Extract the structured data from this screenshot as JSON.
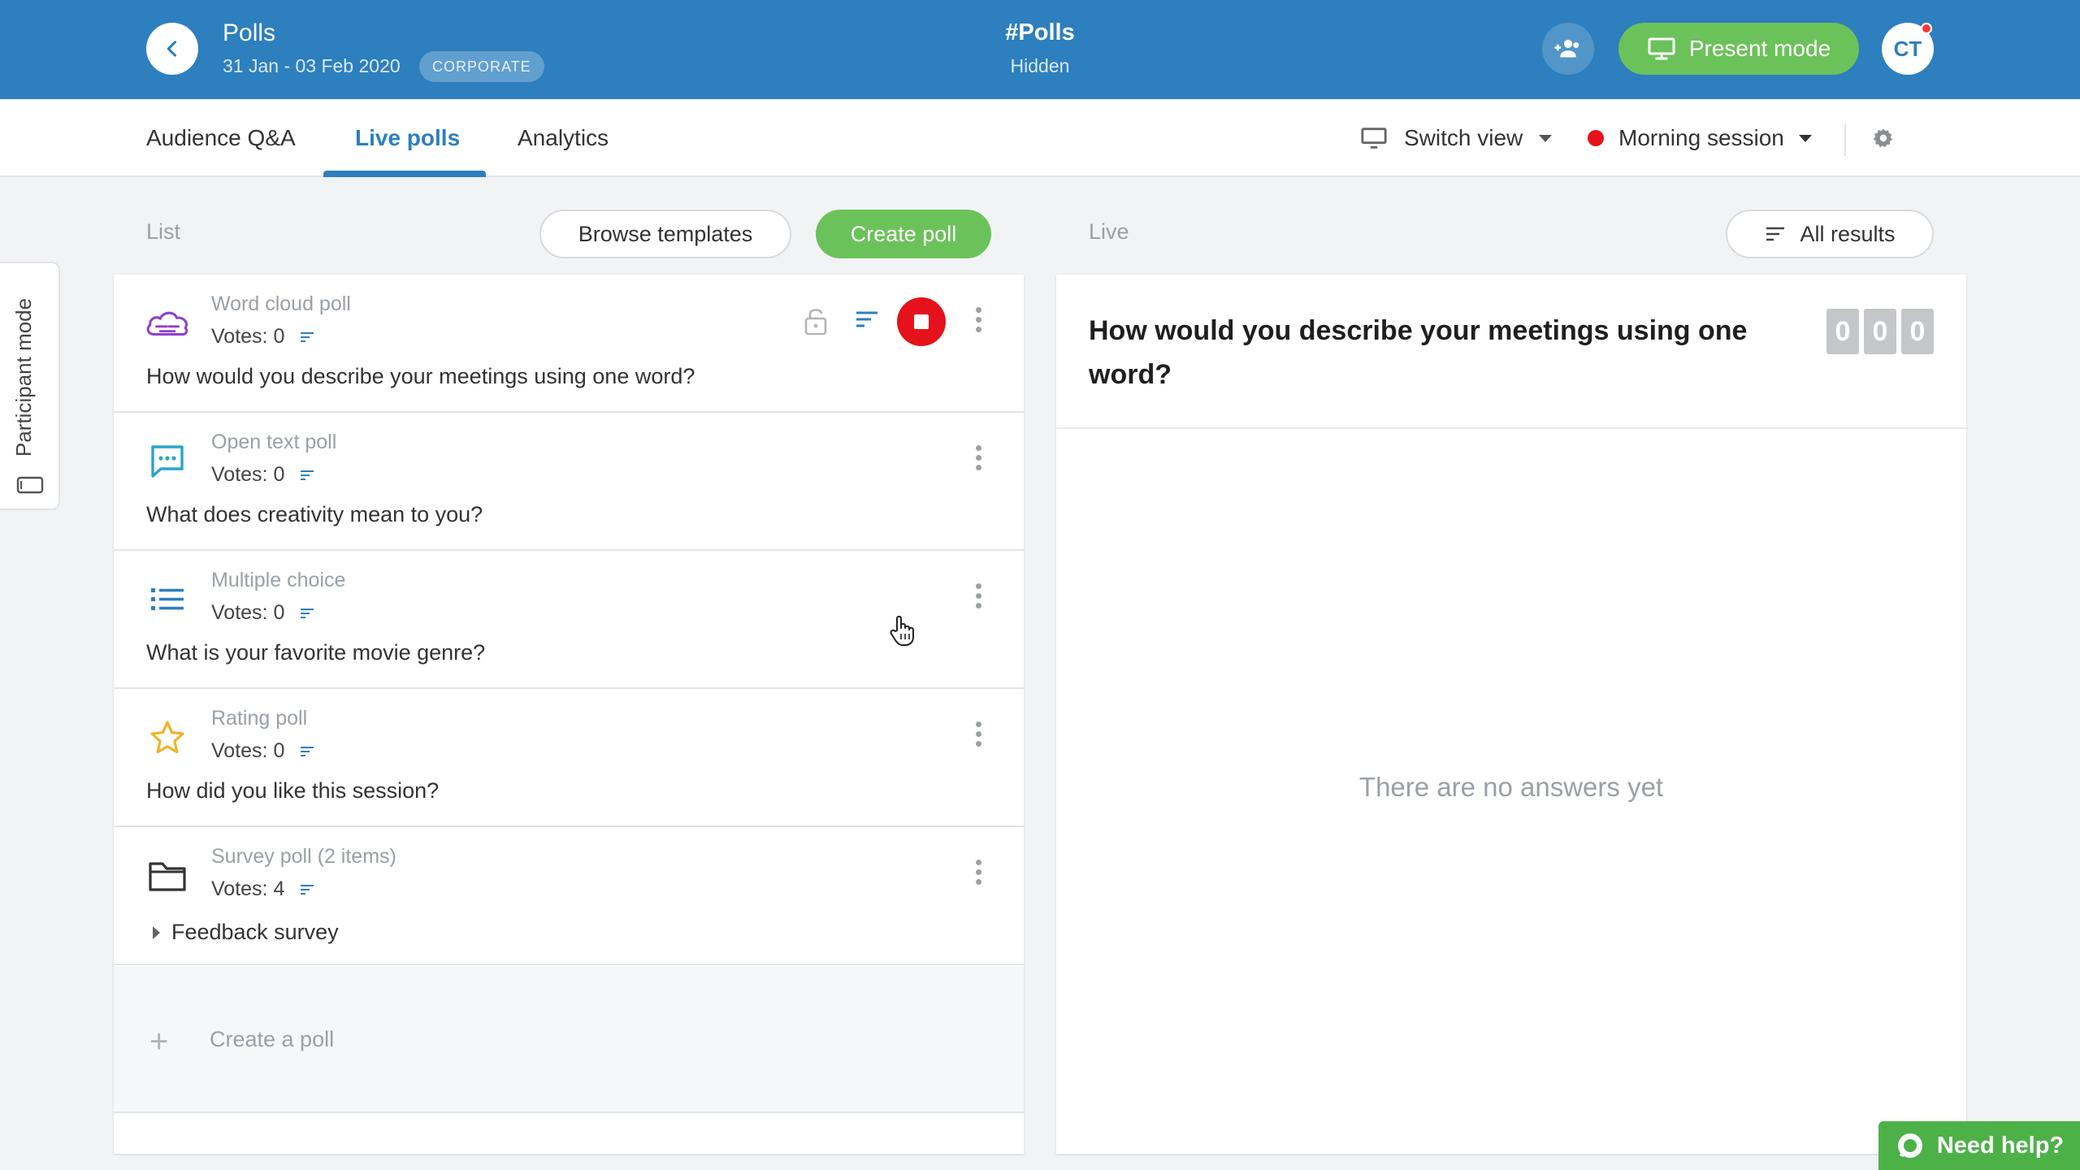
{
  "header": {
    "event_title": "Polls",
    "event_dates": "31 Jan - 03 Feb 2020",
    "event_badge": "CORPORATE",
    "room_title": "#Polls",
    "room_status": "Hidden",
    "present_label": "Present mode",
    "avatar_initials": "CT"
  },
  "tabs": [
    {
      "label": "Audience Q&A",
      "active": false
    },
    {
      "label": "Live polls",
      "active": true
    },
    {
      "label": "Analytics",
      "active": false
    }
  ],
  "toolbar": {
    "switch_view_label": "Switch view",
    "session_label": "Morning session"
  },
  "participant": {
    "label": "Participant mode"
  },
  "list": {
    "label": "List",
    "browse_label": "Browse templates",
    "create_label": "Create poll",
    "items": [
      {
        "type": "Word cloud poll",
        "votes": "Votes: 0",
        "question": "How would you describe your meetings using one word?",
        "icon": "word-cloud-icon",
        "live": true
      },
      {
        "type": "Open text poll",
        "votes": "Votes: 0",
        "question": "What does creativity mean to you?",
        "icon": "chat-bubble-icon"
      },
      {
        "type": "Multiple choice",
        "votes": "Votes: 0",
        "question": "What is your favorite movie genre?",
        "icon": "list-icon"
      },
      {
        "type": "Rating poll",
        "votes": "Votes: 0",
        "question": "How did you like this session?",
        "icon": "star-icon"
      },
      {
        "type": "Survey poll (2 items)",
        "votes": "Votes: 4",
        "sub_item": "Feedback survey",
        "icon": "folder-icon"
      }
    ],
    "add_label": "Create a poll"
  },
  "live": {
    "label": "Live",
    "all_results_label": "All results",
    "question": "How would you describe your meetings using one word?",
    "counter": [
      "0",
      "0",
      "0"
    ],
    "empty_text": "There are no answers yet"
  },
  "help": {
    "label": "Need help?"
  },
  "colors": {
    "brand_blue": "#2d7fbe",
    "green": "#6cc25a",
    "live_red": "#e5121b",
    "help_green": "#4cb147"
  }
}
